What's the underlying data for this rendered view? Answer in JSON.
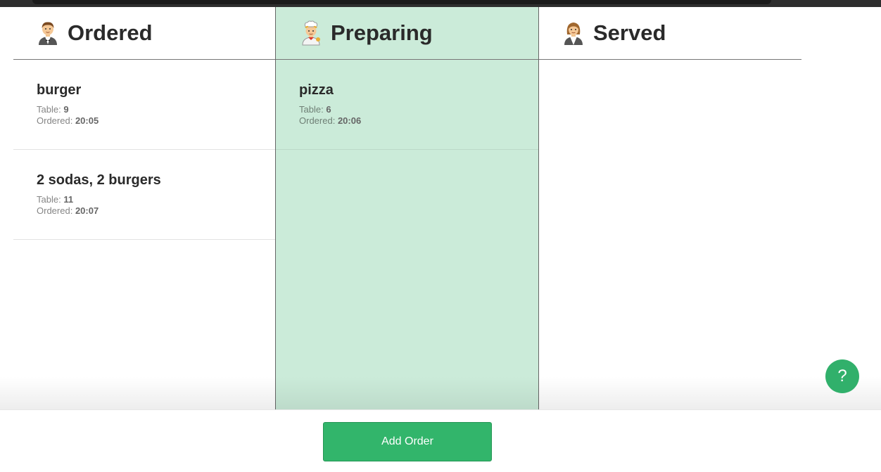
{
  "columns": {
    "ordered": {
      "title": "Ordered",
      "icon": "waiter-man-icon",
      "orders": [
        {
          "name": "burger",
          "table_label": "Table:",
          "table": "9",
          "ordered_label": "Ordered:",
          "time": "20:05"
        },
        {
          "name": "2 sodas, 2 burgers",
          "table_label": "Table:",
          "table": "11",
          "ordered_label": "Ordered:",
          "time": "20:07"
        }
      ]
    },
    "preparing": {
      "title": "Preparing",
      "icon": "chef-icon",
      "orders": [
        {
          "name": "pizza",
          "table_label": "Table:",
          "table": "6",
          "ordered_label": "Ordered:",
          "time": "20:06"
        }
      ]
    },
    "served": {
      "title": "Served",
      "icon": "waitress-woman-icon",
      "orders": []
    }
  },
  "actions": {
    "add_order": "Add Order",
    "help": "?"
  },
  "colors": {
    "accent": "#32b56b",
    "preparing_bg": "#cbebd9"
  }
}
